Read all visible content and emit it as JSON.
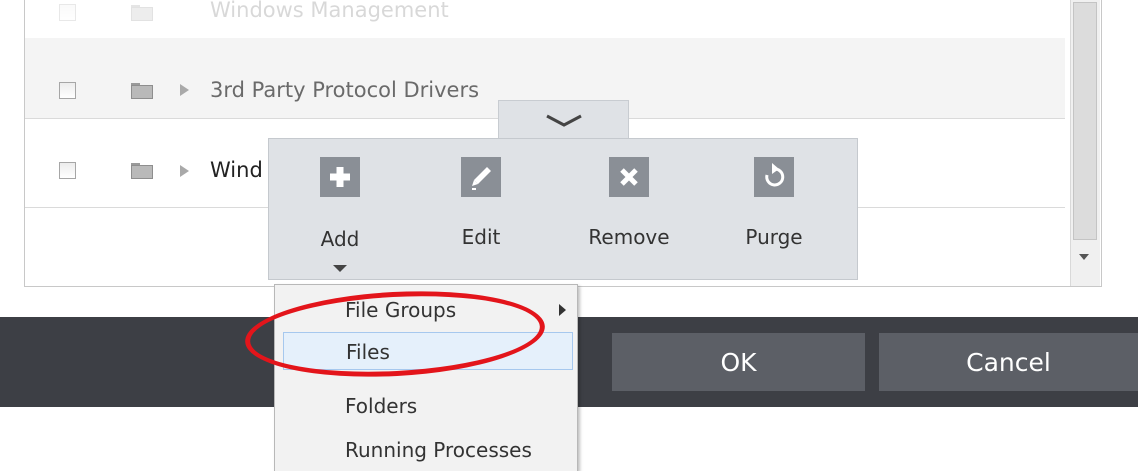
{
  "list": {
    "rows": [
      {
        "label": "Windows Management",
        "faded": true
      },
      {
        "label": "3rd Party Protocol Drivers",
        "faded": false
      },
      {
        "label": "Wind",
        "faded": false
      }
    ]
  },
  "toolbar": {
    "add_label": "Add",
    "edit_label": "Edit",
    "remove_label": "Remove",
    "purge_label": "Purge",
    "icons": {
      "add": "plus-icon",
      "edit": "pencil-icon",
      "remove": "x-icon",
      "purge": "refresh-icon"
    }
  },
  "add_menu": {
    "items": [
      "File Groups",
      "Files",
      "Folders",
      "Running Processes"
    ],
    "highlighted": "Files"
  },
  "footer": {
    "ok_label": "OK",
    "cancel_label": "Cancel"
  },
  "colors": {
    "highlight_oval": "#e3151b",
    "footer_bg": "#3d3f45",
    "button_bg": "#5c5f66",
    "toolbar_bg": "#dfe2e6"
  }
}
